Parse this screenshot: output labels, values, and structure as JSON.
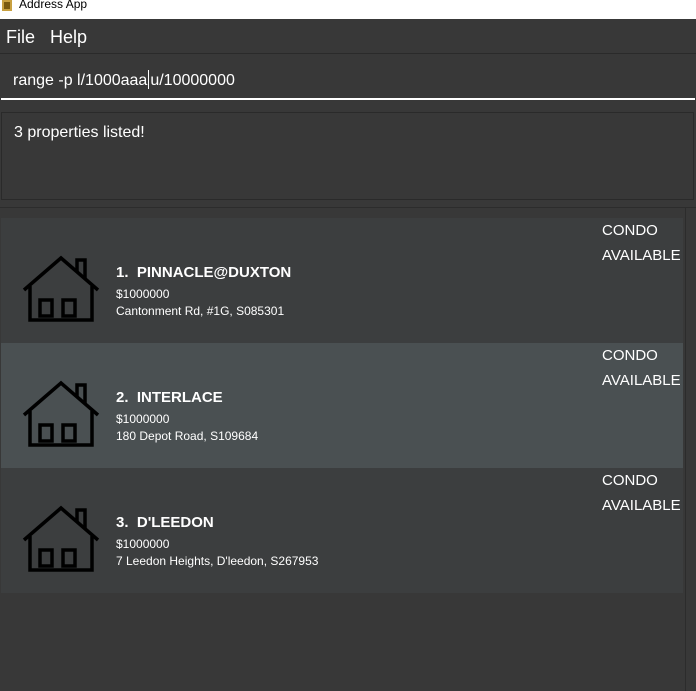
{
  "window": {
    "title": "Address App",
    "icon": "app-icon"
  },
  "menu": [
    {
      "label": "File"
    },
    {
      "label": "Help"
    }
  ],
  "command": {
    "before_caret": "range -p l/1000aaa",
    "after_caret": "u/10000000"
  },
  "result": {
    "message": "3 properties listed!"
  },
  "properties": [
    {
      "index": "1.",
      "name": "PINNACLE@DUXTON",
      "price": "$1000000",
      "address": "Cantonment Rd, #1G, S085301",
      "type": "CONDO",
      "status": "AVAILABLE",
      "icon": "house-icon"
    },
    {
      "index": "2.",
      "name": "INTERLACE",
      "price": "$1000000",
      "address": "180 Depot Road, S109684",
      "type": "CONDO",
      "status": "AVAILABLE",
      "icon": "house-icon",
      "selected": true
    },
    {
      "index": "3.",
      "name": "D'LEEDON",
      "price": "$1000000",
      "address": "7 Leedon Heights, D'leedon, S267953",
      "type": "CONDO",
      "status": "AVAILABLE",
      "icon": "house-icon"
    }
  ],
  "colors": {
    "background": "#383838",
    "card": "#3c3e3f",
    "card_selected": "#4a5052",
    "text": "#ffffff"
  }
}
